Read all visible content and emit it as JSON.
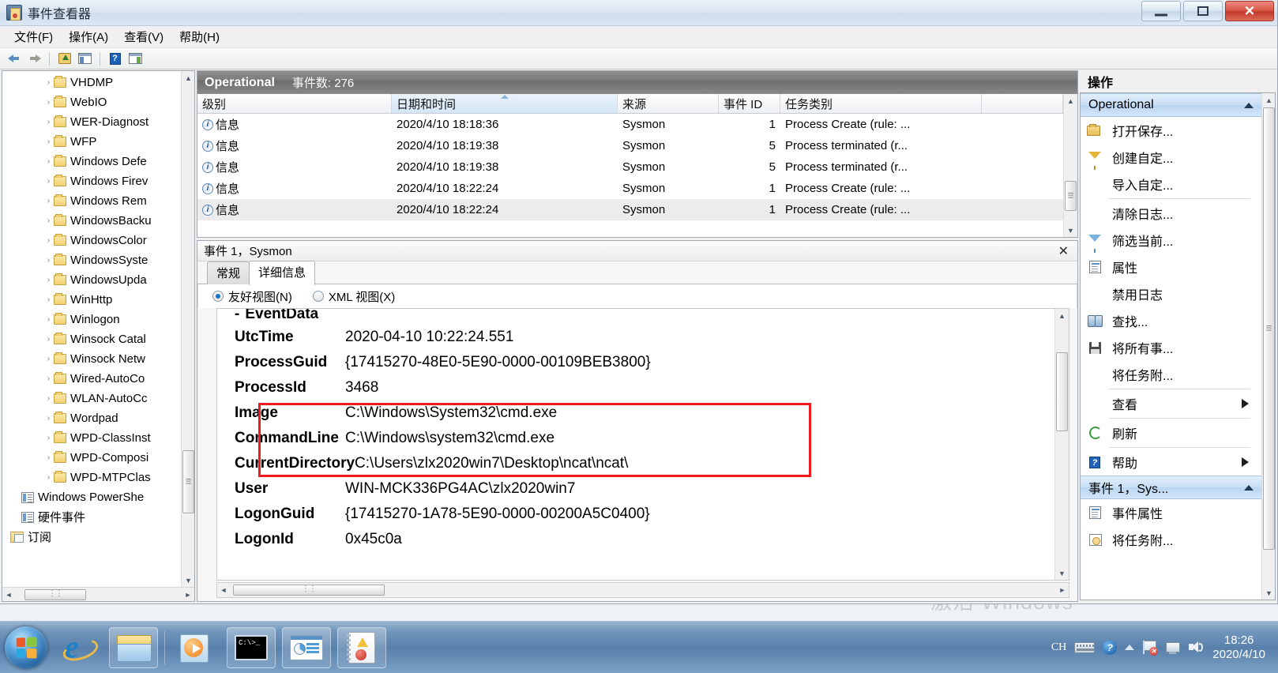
{
  "window": {
    "title": "事件查看器",
    "icon": "event-viewer-icon",
    "buttons": {
      "minimize": "minimize",
      "maximize": "maximize",
      "close": "close"
    }
  },
  "menubar": {
    "items": [
      {
        "label": "文件(F)"
      },
      {
        "label": "操作(A)"
      },
      {
        "label": "查看(V)"
      },
      {
        "label": "帮助(H)"
      }
    ]
  },
  "toolbar": {
    "buttons": [
      {
        "name": "back-button",
        "icon": "arrow-left-icon"
      },
      {
        "name": "forward-button",
        "icon": "arrow-right-icon"
      },
      {
        "name": "up-one-level-button",
        "icon": "folder-up-icon"
      },
      {
        "name": "show-hide-console-tree-button",
        "icon": "left-pane-icon"
      },
      {
        "name": "help-button",
        "icon": "help-icon"
      },
      {
        "name": "show-hide-action-pane-button",
        "icon": "right-pane-icon"
      }
    ]
  },
  "tree": {
    "nodes": [
      {
        "label": "VHDMP",
        "type": "folder",
        "indent": 3
      },
      {
        "label": "WebIO",
        "type": "folder",
        "indent": 3
      },
      {
        "label": "WER-Diagnost",
        "type": "folder",
        "indent": 3
      },
      {
        "label": "WFP",
        "type": "folder",
        "indent": 3
      },
      {
        "label": "Windows Defe",
        "type": "folder",
        "indent": 3
      },
      {
        "label": "Windows Firev",
        "type": "folder",
        "indent": 3
      },
      {
        "label": "Windows Rem",
        "type": "folder",
        "indent": 3
      },
      {
        "label": "WindowsBacku",
        "type": "folder",
        "indent": 3
      },
      {
        "label": "WindowsColor",
        "type": "folder",
        "indent": 3
      },
      {
        "label": "WindowsSyste",
        "type": "folder",
        "indent": 3
      },
      {
        "label": "WindowsUpda",
        "type": "folder",
        "indent": 3
      },
      {
        "label": "WinHttp",
        "type": "folder",
        "indent": 3
      },
      {
        "label": "Winlogon",
        "type": "folder",
        "indent": 3
      },
      {
        "label": "Winsock Catal",
        "type": "folder",
        "indent": 3
      },
      {
        "label": "Winsock Netw",
        "type": "folder",
        "indent": 3
      },
      {
        "label": "Wired-AutoCo",
        "type": "folder",
        "indent": 3
      },
      {
        "label": "WLAN-AutoCc",
        "type": "folder",
        "indent": 3
      },
      {
        "label": "Wordpad",
        "type": "folder",
        "indent": 3
      },
      {
        "label": "WPD-ClassInst",
        "type": "folder",
        "indent": 3
      },
      {
        "label": "WPD-Composi",
        "type": "folder",
        "indent": 3
      },
      {
        "label": "WPD-MTPClas",
        "type": "folder",
        "indent": 3
      },
      {
        "label": "Windows PowerShe",
        "type": "log",
        "indent": 1
      },
      {
        "label": "硬件事件",
        "type": "log",
        "indent": 1
      },
      {
        "label": "订阅",
        "type": "subscription",
        "indent": 0
      }
    ]
  },
  "list": {
    "header_title": "Operational",
    "header_count": "事件数: 276",
    "columns": [
      {
        "label": "级别",
        "key": "level"
      },
      {
        "label": "日期和时间",
        "key": "datetime",
        "sorted": true
      },
      {
        "label": "来源",
        "key": "source"
      },
      {
        "label": "事件 ID",
        "key": "event_id"
      },
      {
        "label": "任务类别",
        "key": "task"
      },
      {
        "label": "",
        "key": "spacer"
      }
    ],
    "rows": [
      {
        "level": "信息",
        "datetime": "2020/4/10 18:18:36",
        "source": "Sysmon",
        "event_id": "1",
        "task": "Process Create (rule: ...",
        "selected": false
      },
      {
        "level": "信息",
        "datetime": "2020/4/10 18:19:38",
        "source": "Sysmon",
        "event_id": "5",
        "task": "Process terminated (r...",
        "selected": false
      },
      {
        "level": "信息",
        "datetime": "2020/4/10 18:19:38",
        "source": "Sysmon",
        "event_id": "5",
        "task": "Process terminated (r...",
        "selected": false
      },
      {
        "level": "信息",
        "datetime": "2020/4/10 18:22:24",
        "source": "Sysmon",
        "event_id": "1",
        "task": "Process Create (rule: ...",
        "selected": false
      },
      {
        "level": "信息",
        "datetime": "2020/4/10 18:22:24",
        "source": "Sysmon",
        "event_id": "1",
        "task": "Process Create (rule: ...",
        "selected": true
      }
    ]
  },
  "detail": {
    "title": "事件 1，Sysmon",
    "close_label": "✕",
    "tabs": [
      {
        "label": "常规",
        "active": false
      },
      {
        "label": "详细信息",
        "active": true
      }
    ],
    "view_modes": [
      {
        "label": "友好视图(N)",
        "selected": true
      },
      {
        "label": "XML 视图(X)",
        "selected": false
      }
    ],
    "section_label": "EventData",
    "section_toggle": "-",
    "fields": [
      {
        "key": "UtcTime",
        "value": "2020-04-10 10:22:24.551",
        "highlighted": false
      },
      {
        "key": "ProcessGuid",
        "value": "{17415270-48E0-5E90-0000-00109BEB3800}",
        "highlighted": false
      },
      {
        "key": "ProcessId",
        "value": "3468",
        "highlighted": false
      },
      {
        "key": "Image",
        "value": "C:\\Windows\\System32\\cmd.exe",
        "highlighted": true
      },
      {
        "key": "CommandLine",
        "value": "C:\\Windows\\system32\\cmd.exe",
        "highlighted": true
      },
      {
        "key": "CurrentDirectory",
        "value": "C:\\Users\\zlx2020win7\\Desktop\\ncat\\ncat\\",
        "highlighted": true
      },
      {
        "key": "User",
        "value": "WIN-MCK336PG4AC\\zlx2020win7",
        "highlighted": false
      },
      {
        "key": "LogonGuid",
        "value": "{17415270-1A78-5E90-0000-00200A5C0400}",
        "highlighted": false
      },
      {
        "key": "LogonId",
        "value": "0x45c0a",
        "highlighted": false
      }
    ],
    "highlight_color": "#ee1c1c"
  },
  "actions": {
    "header": "操作",
    "groups": [
      {
        "title": "Operational",
        "items": [
          {
            "label": "打开保存...",
            "icon": "open-folder-icon",
            "submenu": false,
            "divider_after": false
          },
          {
            "label": "创建自定...",
            "icon": "funnel-gold-icon",
            "submenu": false,
            "divider_after": false
          },
          {
            "label": "导入自定...",
            "icon": "none",
            "submenu": false,
            "divider_after": true
          },
          {
            "label": "清除日志...",
            "icon": "none",
            "submenu": false,
            "divider_after": false
          },
          {
            "label": "筛选当前...",
            "icon": "funnel-blue-icon",
            "submenu": false,
            "divider_after": false
          },
          {
            "label": "属性",
            "icon": "properties-icon",
            "submenu": false,
            "divider_after": false
          },
          {
            "label": "禁用日志",
            "icon": "none",
            "submenu": false,
            "divider_after": false
          },
          {
            "label": "查找...",
            "icon": "binoculars-icon",
            "submenu": false,
            "divider_after": false
          },
          {
            "label": "将所有事...",
            "icon": "save-icon",
            "submenu": false,
            "divider_after": false
          },
          {
            "label": "将任务附...",
            "icon": "none",
            "submenu": false,
            "divider_after": true
          },
          {
            "label": "查看",
            "icon": "none",
            "submenu": true,
            "divider_after": true
          },
          {
            "label": "刷新",
            "icon": "refresh-icon",
            "submenu": false,
            "divider_after": true
          },
          {
            "label": "帮助",
            "icon": "help-icon",
            "submenu": true,
            "divider_after": false
          }
        ]
      },
      {
        "title": "事件 1，Sys...",
        "items": [
          {
            "label": "事件属性",
            "icon": "properties-icon",
            "submenu": false,
            "divider_after": false
          },
          {
            "label": "将任务附...",
            "icon": "attach-task-icon",
            "submenu": false,
            "divider_after": false
          }
        ]
      }
    ]
  },
  "watermark": {
    "line1": "激活 Windows"
  },
  "taskbar": {
    "start_label": "start-orb",
    "items": [
      {
        "name": "taskbar-internet-explorer",
        "icon": "ie-icon"
      },
      {
        "name": "taskbar-windows-explorer",
        "icon": "folder-icon"
      },
      {
        "name": "taskbar-windows-media-player",
        "icon": "media-player-icon"
      },
      {
        "name": "taskbar-command-prompt",
        "icon": "cmd-icon"
      },
      {
        "name": "taskbar-mmc-console",
        "icon": "mmc-icon"
      },
      {
        "name": "taskbar-event-viewer",
        "icon": "event-viewer-icon"
      }
    ],
    "tray": {
      "ime": "CH",
      "icons": [
        "keyboard-icon",
        "help-icon",
        "show-hidden-icon",
        "action-center-flag-icon",
        "network-icon",
        "volume-icon"
      ]
    },
    "clock_time": "18:26",
    "clock_date": "2020/4/10"
  }
}
